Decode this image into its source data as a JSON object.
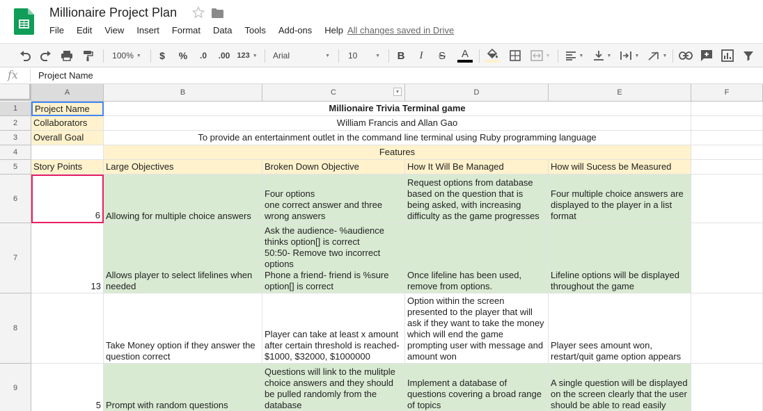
{
  "doc": {
    "title": "Millionaire Project Plan",
    "save_status": "All changes saved in Drive"
  },
  "menu": [
    "File",
    "Edit",
    "View",
    "Insert",
    "Format",
    "Data",
    "Tools",
    "Add-ons",
    "Help"
  ],
  "toolbar": {
    "zoom": "100%",
    "currency": "$",
    "percent": "%",
    "decimal_decrease": ".0",
    "decimal_increase": ".00",
    "more_formats": "123",
    "font": "Arial",
    "font_size": "10",
    "bold": "B",
    "italic": "I",
    "strike": "S",
    "text_color": "A",
    "text_color_value": "#000000",
    "fill_color_value": "#fff2cc"
  },
  "formula_bar": {
    "fx": "fx",
    "value": "Project Name"
  },
  "columns": [
    "A",
    "B",
    "C",
    "D",
    "E",
    "F"
  ],
  "rows": [
    "1",
    "2",
    "3",
    "4",
    "5",
    "6",
    "7",
    "8",
    "9"
  ],
  "cells": {
    "r1": {
      "a": "Project Name",
      "merged": "Millionaire Trivia Terminal game"
    },
    "r2": {
      "a": "Collaborators",
      "merged": "William Francis and Allan Gao"
    },
    "r3": {
      "a": "Overall Goal",
      "merged": "To provide an entertainment outlet in the command line terminal using Ruby programming language"
    },
    "r4": {
      "merged": "Features"
    },
    "r5": {
      "a": "Story Points",
      "b": "Large Objectives",
      "c": "Broken Down Objective",
      "d": "How It Will Be Managed",
      "e": "How will Sucess be Measured"
    },
    "r6": {
      "a": "6",
      "b": "Allowing for multiple choice answers",
      "c": "Four options\none correct answer and three wrong answers",
      "d": "Request options from database based on the question that is being asked, with increasing difficulty as the game progresses",
      "e": "Four multiple choice answers are displayed to the player in a list format"
    },
    "r7": {
      "a": "13",
      "b": "Allows player to select lifelines when needed",
      "c": "Ask the audience- %audience thinks option[] is correct\n50:50- Remove two incorrect options\nPhone a friend- friend is %sure option[] is correct",
      "d": "Once lifeline has been used, remove from options.",
      "e": "Lifeline options will be displayed throughout the game"
    },
    "r8": {
      "a": "",
      "b": "Take Money option if they answer the question correct",
      "c": "Player can take at least x amount after certain threshold is reached- $1000, $32000, $1000000",
      "d": "Option within the screen presented to the player that will ask if they want to take the money which will end the game prompting user with message and amount won",
      "e": "Player sees amount won, restart/quit game option appears"
    },
    "r9": {
      "a": "5",
      "b": "Prompt with random questions",
      "c": "Questions will link to the mulitple choice answers and they should be pulled randomly from the database",
      "d": "Implement a database of questions covering a broad range of topics",
      "e": "A single question will be displayed on the screen clearly that the user should be able to read easily"
    }
  },
  "colors": {
    "header_yellow": "#fff2cc",
    "body_green": "#d9ead3",
    "selection": "#e91e63",
    "active_cell": "#4285f4",
    "sheets_green": "#0f9d58"
  }
}
